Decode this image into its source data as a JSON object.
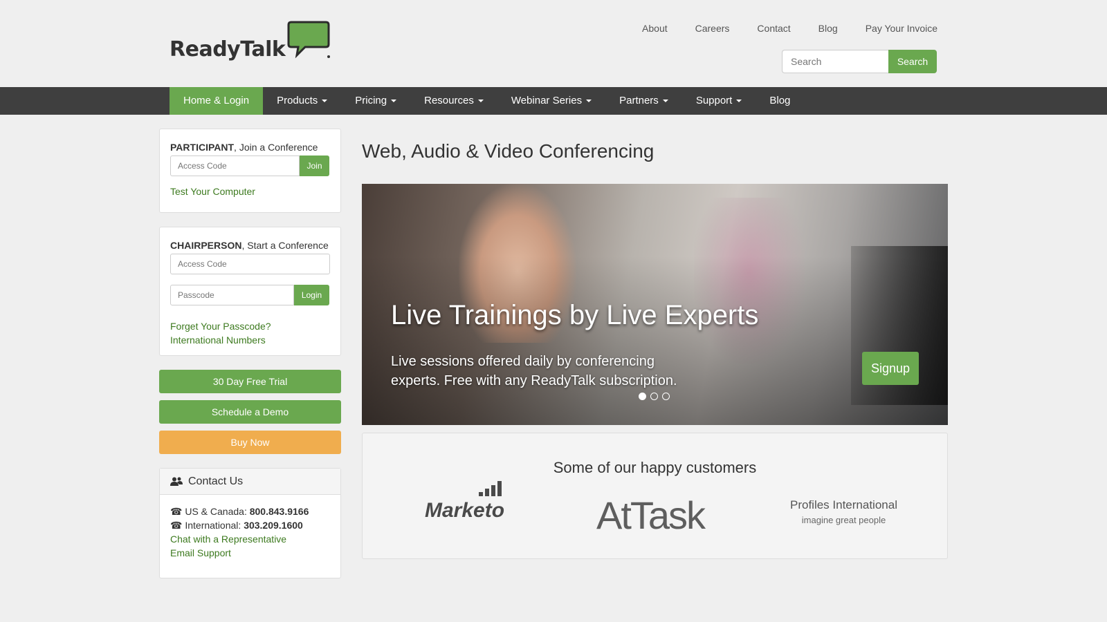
{
  "brand": {
    "name": "ReadyTalk",
    "accent": "#6aa84f",
    "orange": "#f0ad4e",
    "nav_bg": "#3f3f3f"
  },
  "top_links": [
    "About",
    "Careers",
    "Contact",
    "Blog",
    "Pay Your Invoice"
  ],
  "search": {
    "placeholder": "Search",
    "button": "Search"
  },
  "nav": {
    "items": [
      {
        "label": "Home & Login",
        "dropdown": false,
        "active": true
      },
      {
        "label": "Products",
        "dropdown": true
      },
      {
        "label": "Pricing",
        "dropdown": true
      },
      {
        "label": "Resources",
        "dropdown": true
      },
      {
        "label": "Webinar Series",
        "dropdown": true
      },
      {
        "label": "Partners",
        "dropdown": true
      },
      {
        "label": "Support",
        "dropdown": true
      },
      {
        "label": "Blog",
        "dropdown": false
      }
    ]
  },
  "participant": {
    "title_bold": "PARTICIPANT",
    "title_rest": ", Join a Conference",
    "access_placeholder": "Access Code",
    "join_button": "Join",
    "test_link": "Test Your Computer"
  },
  "chairperson": {
    "title_bold": "CHAIRPERSON",
    "title_rest": ", Start a Conference",
    "access_placeholder": "Access Code",
    "passcode_placeholder": "Passcode",
    "login_button": "Login",
    "forgot_link": "Forget Your Passcode?",
    "intl_link": "International Numbers"
  },
  "cta": {
    "trial": "30 Day Free Trial",
    "demo": "Schedule a Demo",
    "buy": "Buy Now"
  },
  "contact": {
    "title": "Contact Us",
    "us_label": "US & Canada: ",
    "us_number": "800.843.9166",
    "intl_label": "International: ",
    "intl_number": "303.209.1600",
    "chat_link": "Chat with a Representative",
    "email_link": "Email Support"
  },
  "main": {
    "title": "Web, Audio & Video Conferencing",
    "hero": {
      "headline": "Live Trainings by Live Experts",
      "sub": "Live sessions offered daily by conferencing experts. Free with any ReadyTalk subscription.",
      "button": "Signup",
      "slide_count": 3,
      "active_slide": 1
    },
    "customers": {
      "title": "Some of our happy customers",
      "logos": {
        "marketo": "Marketo",
        "atask": "AtTask",
        "profiles_line1": "Profiles International",
        "profiles_line2": "imagine great people"
      }
    }
  }
}
